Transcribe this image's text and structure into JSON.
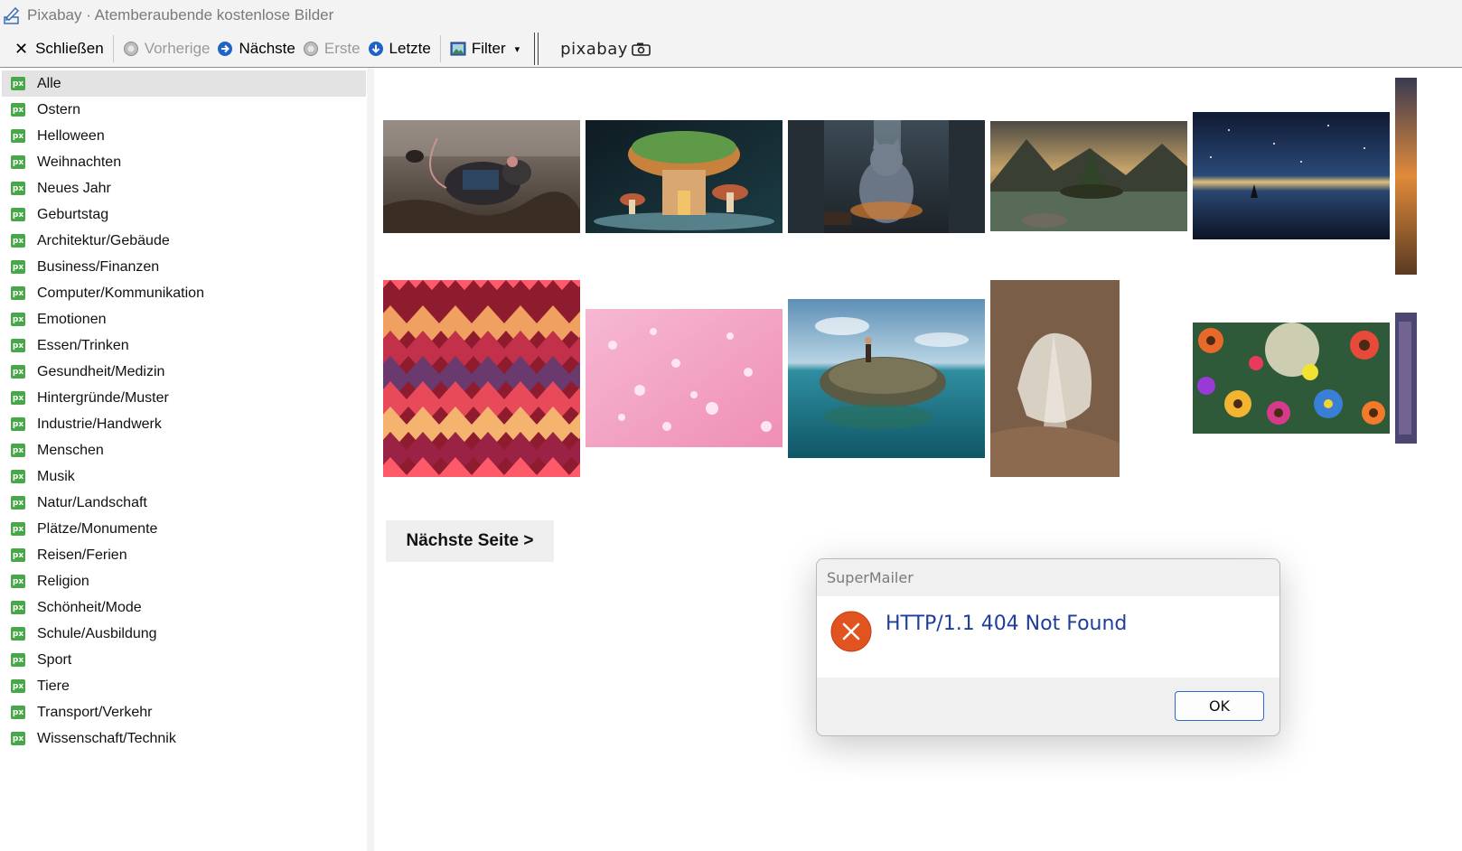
{
  "window": {
    "title": "Pixabay · Atemberaubende kostenlose Bilder"
  },
  "toolbar": {
    "close_label": "Schließen",
    "prev_label": "Vorherige",
    "next_label": "Nächste",
    "first_label": "Erste",
    "last_label": "Letzte",
    "filter_label": "Filter",
    "logo_text": "pixabay"
  },
  "sidebar": {
    "badge": "px",
    "items": [
      {
        "label": "Alle"
      },
      {
        "label": "Ostern"
      },
      {
        "label": "Helloween"
      },
      {
        "label": "Weihnachten"
      },
      {
        "label": "Neues Jahr"
      },
      {
        "label": "Geburtstag"
      },
      {
        "label": "Architektur/Gebäude"
      },
      {
        "label": "Business/Finanzen"
      },
      {
        "label": "Computer/Kommunikation"
      },
      {
        "label": "Emotionen"
      },
      {
        "label": "Essen/Trinken"
      },
      {
        "label": "Gesundheit/Medizin"
      },
      {
        "label": "Hintergründe/Muster"
      },
      {
        "label": "Industrie/Handwerk"
      },
      {
        "label": "Menschen"
      },
      {
        "label": "Musik"
      },
      {
        "label": "Natur/Landschaft"
      },
      {
        "label": "Plätze/Monumente"
      },
      {
        "label": "Reisen/Ferien"
      },
      {
        "label": "Religion"
      },
      {
        "label": "Schönheit/Mode"
      },
      {
        "label": "Schule/Ausbildung"
      },
      {
        "label": "Sport"
      },
      {
        "label": "Tiere"
      },
      {
        "label": "Transport/Verkehr"
      },
      {
        "label": "Wissenschaft/Technik"
      }
    ]
  },
  "content": {
    "next_page_label": "Nächste Seite >"
  },
  "dialog": {
    "title": "SuperMailer",
    "message": "HTTP/1.1 404 Not Found",
    "ok_label": "OK"
  },
  "colors": {
    "accent_badge": "#48a849",
    "error_icon": "#e2541f",
    "message_text": "#1f3e9a",
    "ok_border": "#2c6ad0"
  }
}
